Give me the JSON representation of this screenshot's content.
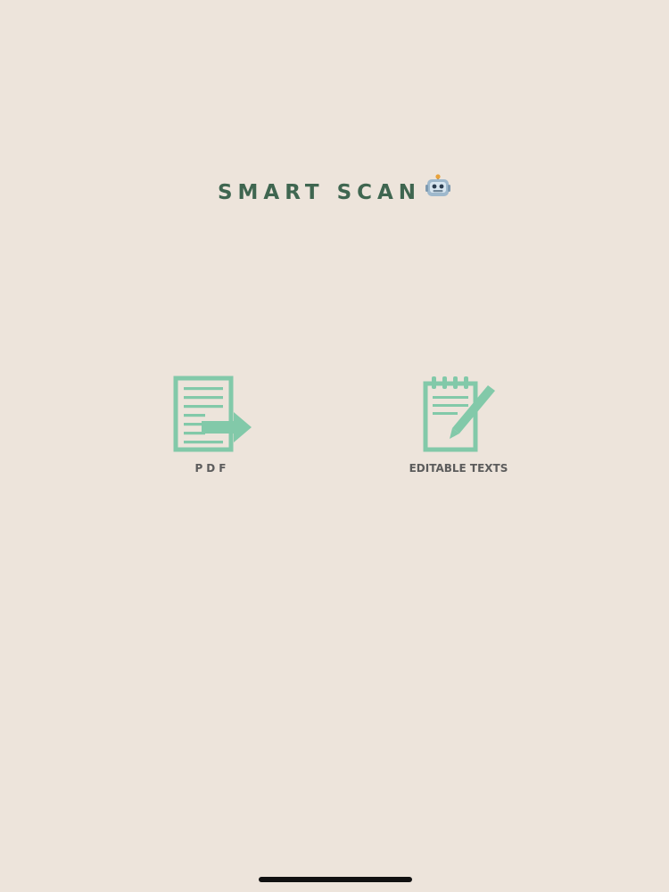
{
  "app": {
    "title": "SMART SCAN",
    "title_icon": "robot-face-icon"
  },
  "options": [
    {
      "label": "PDF",
      "icon": "pdf-export-document-icon"
    },
    {
      "label": "EDITABLE TEXTS",
      "icon": "notepad-pencil-icon"
    }
  ],
  "colors": {
    "background": "#ede4db",
    "title_text": "#3f6650",
    "icon_accent": "#82c9a9",
    "label_text": "#5c5c5c",
    "home_indicator": "#111111"
  }
}
